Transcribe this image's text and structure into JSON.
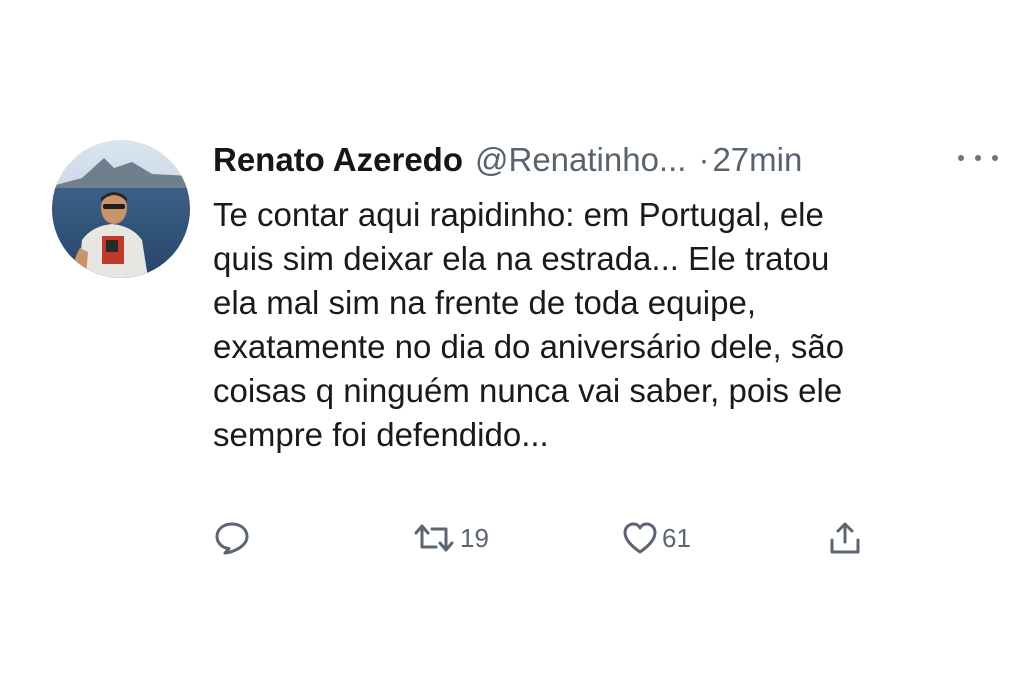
{
  "tweet": {
    "author": {
      "name": "Renato Azeredo",
      "handle": "@Renatinho...",
      "separator": "·",
      "time": "27min"
    },
    "text_lines": [
      "Te contar aqui rapidinho: em Portugal, ele",
      "quis sim deixar ela na estrada... Ele tratou",
      "ela mal sim na frente de toda equipe,",
      "exatamente no dia do aniversário dele, são",
      "coisas q ninguém nunca vai saber, pois ele",
      "sempre foi defendido..."
    ],
    "actions": {
      "reply_icon": "reply-bubble-icon",
      "retweet_icon": "retweet-icon",
      "retweet_count": "19",
      "like_icon": "heart-icon",
      "like_count": "61",
      "share_icon": "share-icon"
    }
  },
  "colors": {
    "text": "#1a1a1a",
    "muted": "#58636e",
    "background": "#ffffff"
  }
}
